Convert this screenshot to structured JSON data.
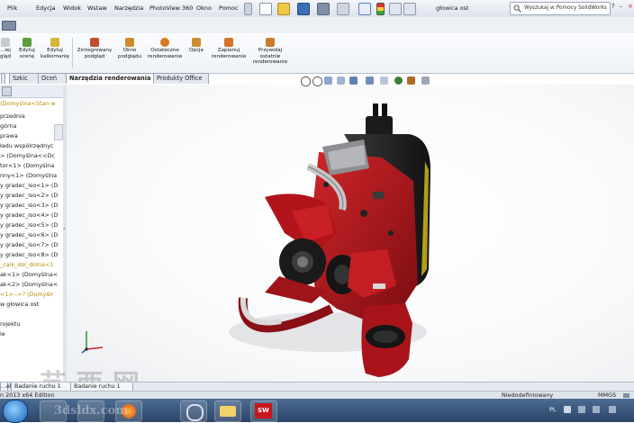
{
  "menubar": {
    "items": [
      "Plik",
      "Edycja",
      "Widok",
      "Wstaw",
      "Narzędzia",
      "PhotoView 360",
      "Okno",
      "Pomoc"
    ],
    "title": "głowica ost",
    "search_placeholder": "Wyszukaj w Pomocy SolidWorks",
    "pin_icon": "pin-icon"
  },
  "ribbon": {
    "buttons": [
      {
        "label": "...iej\ngląd",
        "icon": "view-icon"
      },
      {
        "label": "Edytuj\nscenę",
        "icon": "scene-icon"
      },
      {
        "label": "Edytuj\nkalkomanię",
        "icon": "decal-icon"
      },
      {
        "label": "Zintegrowany\npodgląd",
        "icon": "preview-icon"
      },
      {
        "label": "Okno\npodglądu",
        "icon": "preview-window-icon"
      },
      {
        "label": "Ostateczne\nrenderowanie",
        "icon": "render-icon"
      },
      {
        "label": "Opcje",
        "icon": "options-icon"
      },
      {
        "label": "Zaplanuj\nrenderowanie",
        "icon": "schedule-icon"
      },
      {
        "label": "Przywołaj\nostatnie\nrenderowanie",
        "icon": "recall-icon"
      }
    ]
  },
  "tabs": [
    "Szkic",
    "Oceń",
    "Narzędzia renderowania",
    "Produkty Office"
  ],
  "active_tab": "Narzędzia renderowania",
  "tree": {
    "header": "(Domyślna<Stan w",
    "items": [
      "przednia",
      "górna",
      "prawa",
      "ładu współrzędnyc",
      "> (Domyślna<<Dc",
      "tor<1> (Domyślna",
      "nny<1> (Domyślna",
      "y gradec_iso<1> (D",
      "y gradec_iso<2> (D",
      "y gradec_iso<3> (D",
      "y gradec_iso<4> (D",
      "y gradec_iso<5> (D",
      "y gradec_iso<6> (D",
      "y gradec_iso<7> (D",
      "y gradec_iso<8> (D",
      "_calk_dol_dolna<1",
      "ak<1> (Domyślna<",
      "ak<2> (Domyślna<",
      "<1>-->? (Domyślr",
      "w głowica ost",
      "",
      "rojektu",
      "ie"
    ],
    "highlight_indices": [
      15,
      18
    ]
  },
  "bottom_tabs": [
    "...el",
    "Badanie ruchu 1",
    "Badanie ruchu 1"
  ],
  "status": {
    "left": "n 2013 x64 Edition",
    "center": "Niedodefiniowany",
    "units": "MMGS"
  },
  "taskbar": {
    "lang": "PL",
    "watermark": "3dsldx.com",
    "apps": [
      "explorer-icon",
      "media-player-icon",
      "browser-icon",
      "clock-icon",
      "folder-icon",
      "solidworks-icon"
    ]
  },
  "colors": {
    "accent_red": "#b5121b",
    "dark_metal": "#2a2a2a",
    "taskbar": "#2b4466"
  }
}
